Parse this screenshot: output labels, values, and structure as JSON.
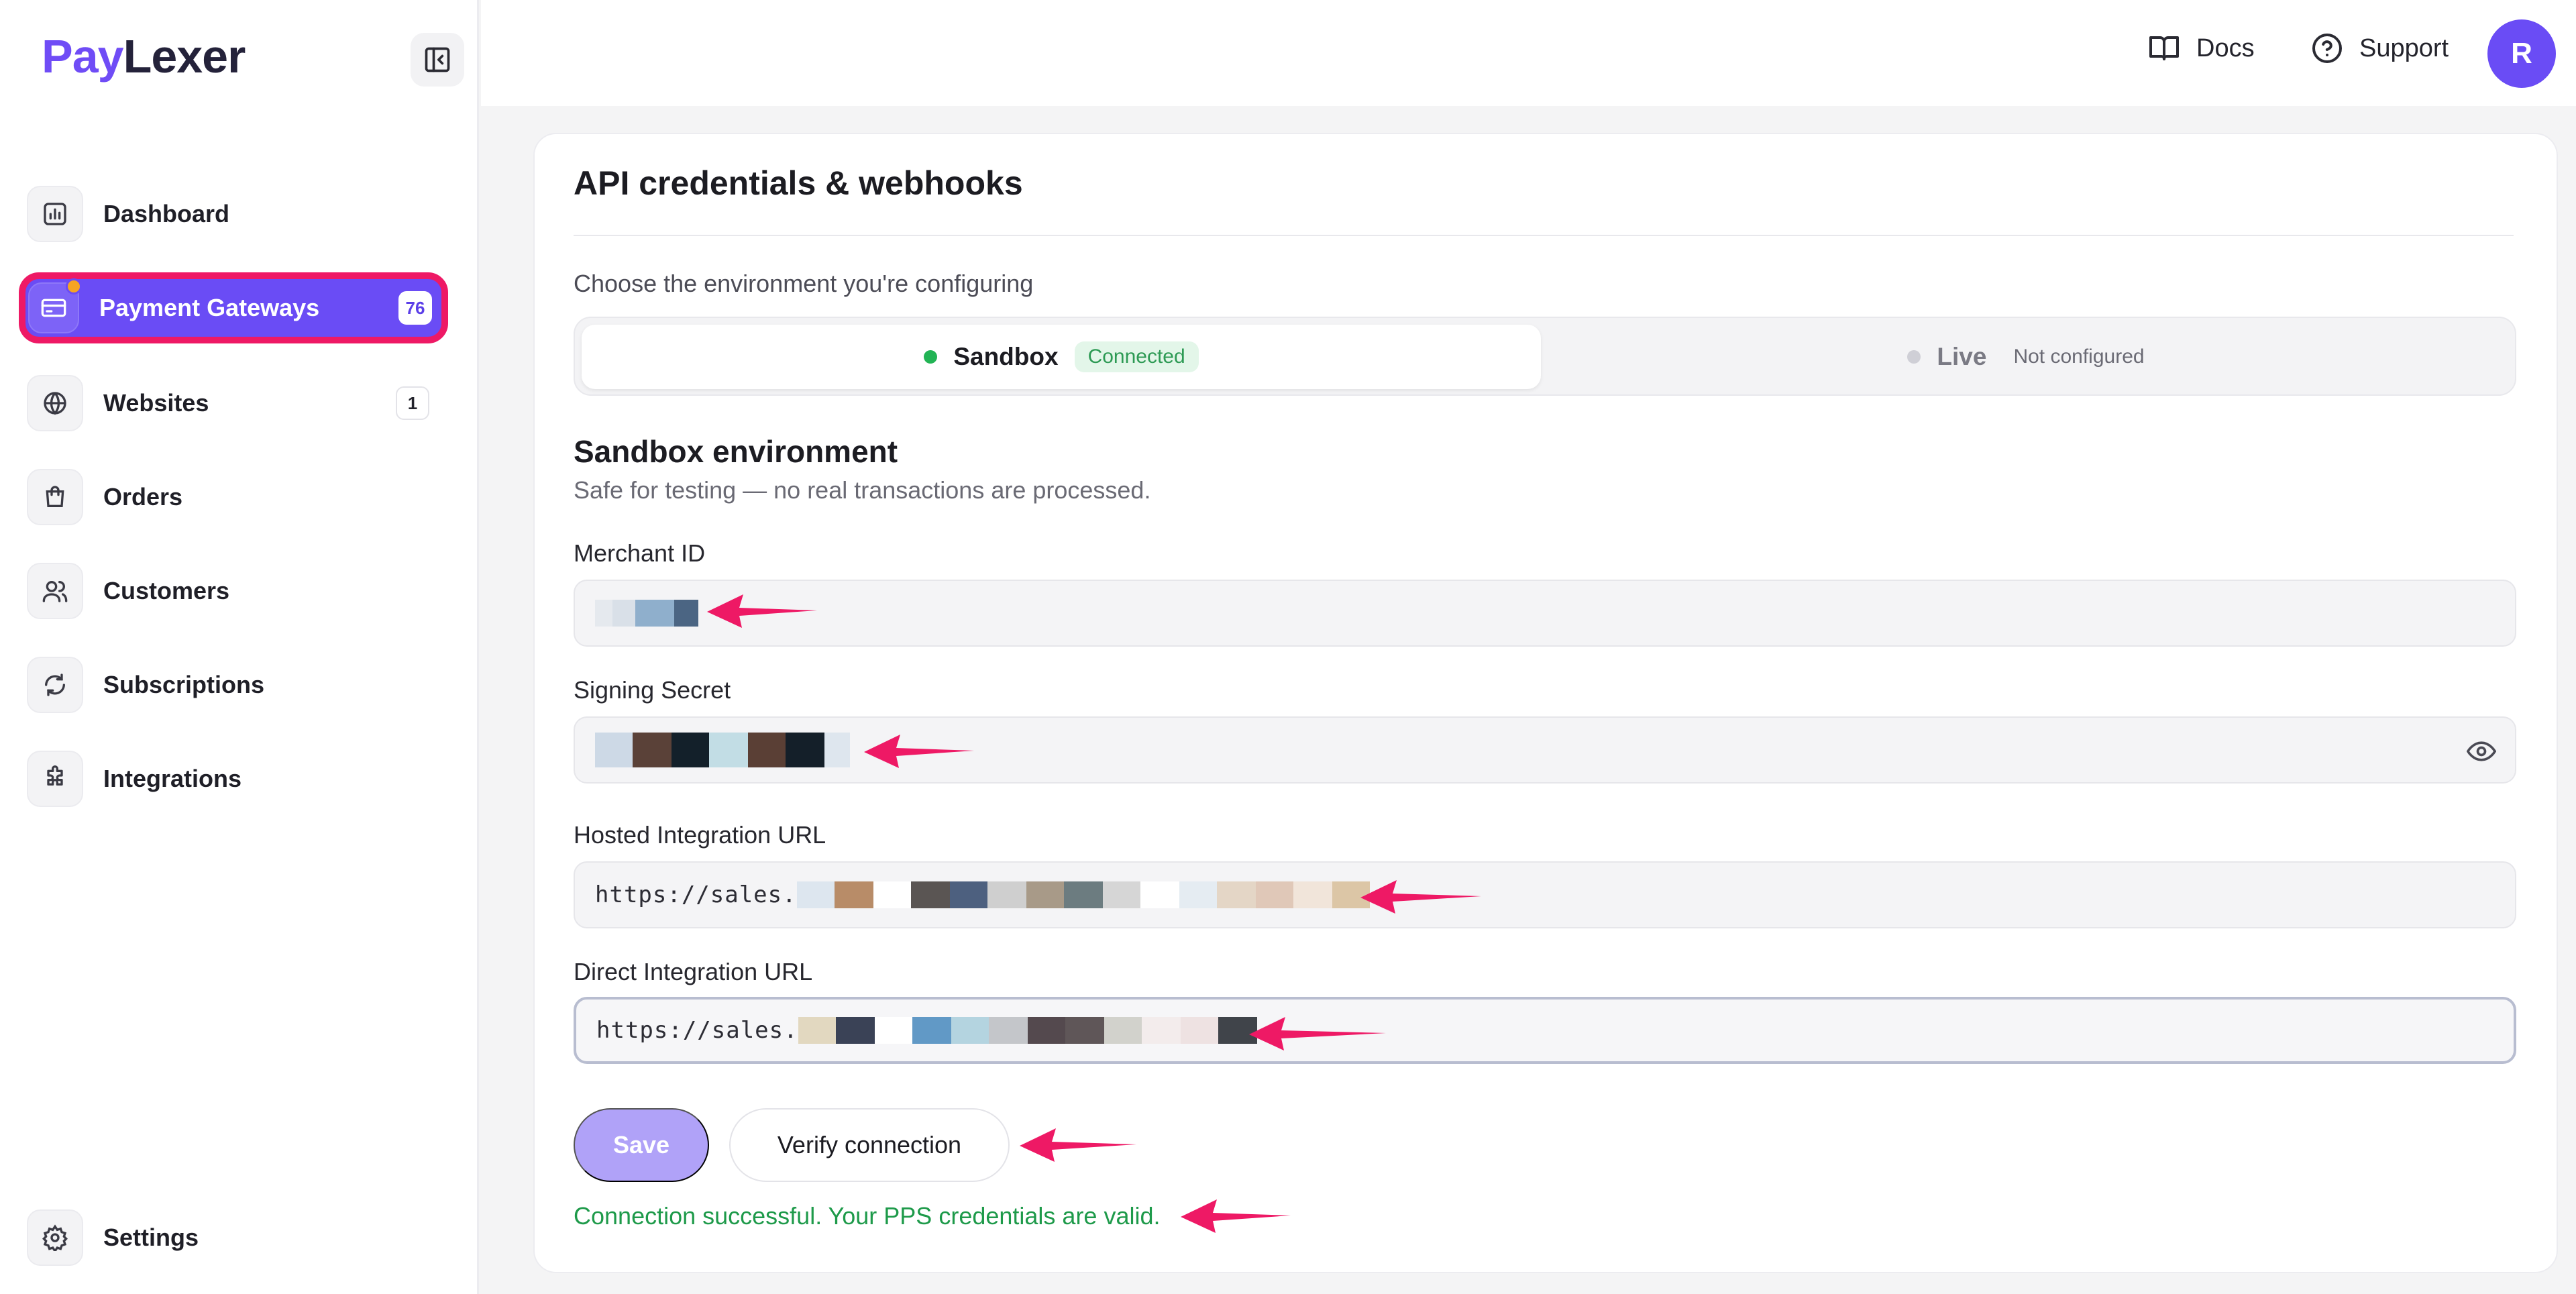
{
  "brand": {
    "part1": "Pay",
    "part2": "Lexer"
  },
  "sidebar": {
    "items": [
      {
        "label": "Dashboard",
        "icon": "chart-icon"
      },
      {
        "label": "Payment Gateways",
        "icon": "credit-card-icon",
        "badge": "76",
        "active": true
      },
      {
        "label": "Websites",
        "icon": "globe-icon",
        "badge": "1"
      },
      {
        "label": "Orders",
        "icon": "shopping-bag-icon"
      },
      {
        "label": "Customers",
        "icon": "users-icon"
      },
      {
        "label": "Subscriptions",
        "icon": "refresh-icon"
      },
      {
        "label": "Integrations",
        "icon": "puzzle-icon"
      }
    ],
    "settings_label": "Settings"
  },
  "topbar": {
    "docs": "Docs",
    "support": "Support",
    "avatar_initial": "R"
  },
  "card": {
    "title": "API credentials & webhooks",
    "env_prompt": "Choose the environment you're configuring",
    "env": {
      "sandbox": {
        "label": "Sandbox",
        "status": "Connected"
      },
      "live": {
        "label": "Live",
        "status": "Not configured"
      }
    },
    "section_title": "Sandbox environment",
    "section_subtitle": "Safe for testing — no real transactions are processed.",
    "fields": {
      "merchant_id": {
        "label": "Merchant ID"
      },
      "signing_secret": {
        "label": "Signing Secret"
      },
      "hosted_url": {
        "label": "Hosted Integration URL",
        "value_prefix": "https://sales."
      },
      "direct_url": {
        "label": "Direct Integration URL",
        "value_prefix": "https://sales."
      }
    },
    "save_label": "Save",
    "verify_label": "Verify connection",
    "success_message": "Connection successful. Your PPS credentials are valid."
  },
  "colors": {
    "accent": "#6a4cf5",
    "highlight": "#ee1965",
    "success": "#1e9a4a",
    "annotation_arrow": "#ee1965"
  }
}
